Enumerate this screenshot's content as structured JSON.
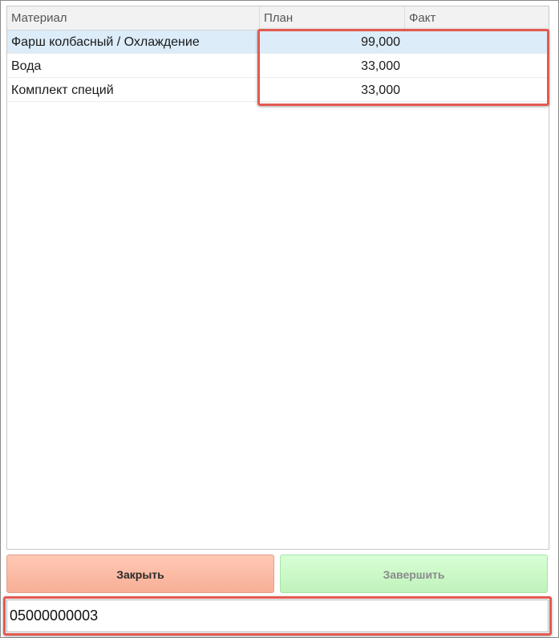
{
  "table": {
    "columns": [
      "Материал",
      "План",
      "Факт"
    ],
    "rows": [
      {
        "material": "Фарш колбасный / Охлаждение",
        "plan": "99,000",
        "fact": "",
        "selected": true
      },
      {
        "material": "Вода",
        "plan": "33,000",
        "fact": "",
        "selected": false
      },
      {
        "material": "Комплект специй",
        "plan": "33,000",
        "fact": "",
        "selected": false
      }
    ]
  },
  "buttons": {
    "close_label": "Закрыть",
    "finish_label": "Завершить"
  },
  "scan_input": {
    "value": "05000000003"
  },
  "colors": {
    "highlight": "#e25a50",
    "close_button": "#f7ae96",
    "finish_button": "#bff2bb",
    "selected_row": "#dcecf9"
  }
}
